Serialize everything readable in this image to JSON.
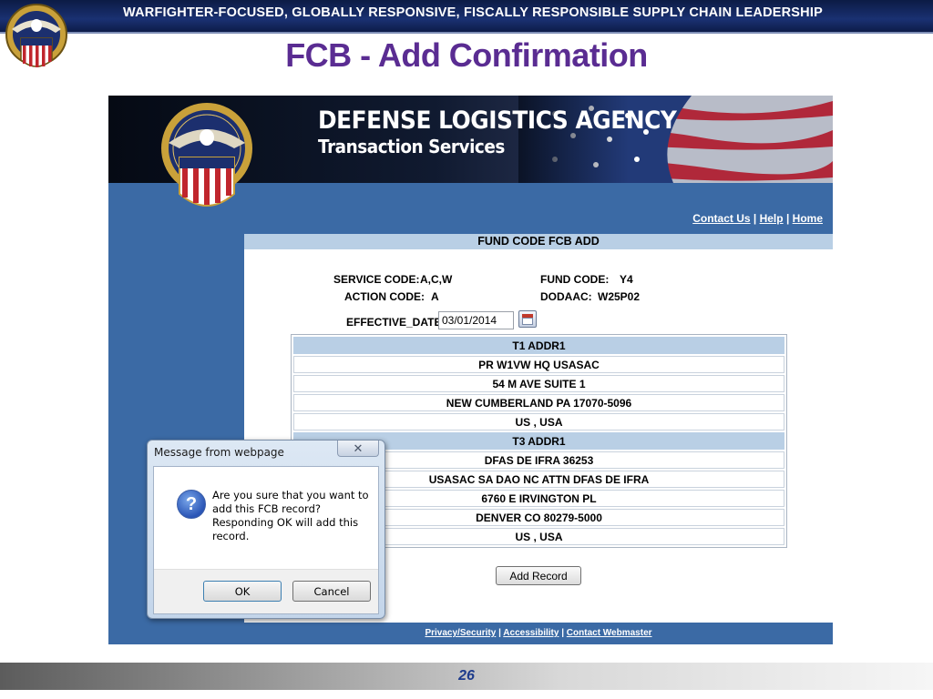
{
  "slide": {
    "banner_text": "WARFIGHTER-FOCUSED, GLOBALLY RESPONSIVE, FISCALLY RESPONSIBLE SUPPLY CHAIN LEADERSHIP",
    "title": "FCB - Add Confirmation",
    "page_number": "26"
  },
  "app": {
    "agency_name": "DEFENSE LOGISTICS AGENCY",
    "agency_sub": "Transaction Services",
    "top_links": [
      "Contact Us",
      "Help",
      "Home"
    ],
    "section_heading": "FUND CODE FCB ADD",
    "fields": {
      "service_code_label": "SERVICE CODE:",
      "service_code_value": "A,C,W",
      "fund_code_label": "FUND CODE:",
      "fund_code_value": "Y4",
      "action_code_label": "ACTION CODE:",
      "action_code_value": "A",
      "dodaac_label": "DODAAC:",
      "dodaac_value": "W25P02",
      "effective_date_label": "EFFECTIVE_DATE:",
      "effective_date_value": "03/01/2014"
    },
    "t1_header": "T1 ADDR1",
    "t1_lines": [
      "PR W1VW HQ USASAC",
      "54 M AVE SUITE 1",
      "NEW CUMBERLAND PA 17070-5096",
      "US , USA"
    ],
    "t3_header": "T3 ADDR1",
    "t3_lines": [
      "DFAS DE IFRA 36253",
      "USASAC SA DAO NC ATTN DFAS DE IFRA",
      "6760 E IRVINGTON PL",
      "DENVER CO 80279-5000",
      "US , USA"
    ],
    "add_record_label": "Add Record",
    "bottom_links": [
      "Privacy/Security",
      "Accessibility",
      "Contact Webmaster"
    ]
  },
  "dialog": {
    "title": "Message from webpage",
    "message": "Are you sure that you want to add this FCB record? Responding OK will add this record.",
    "ok_label": "OK",
    "cancel_label": "Cancel",
    "icon": "question-icon"
  },
  "colors": {
    "banner": "#1a3172",
    "title": "#5a2c92",
    "app_blue": "#3b6aa5",
    "table_header": "#b9cfe5",
    "page_number": "#1e3c8c"
  }
}
